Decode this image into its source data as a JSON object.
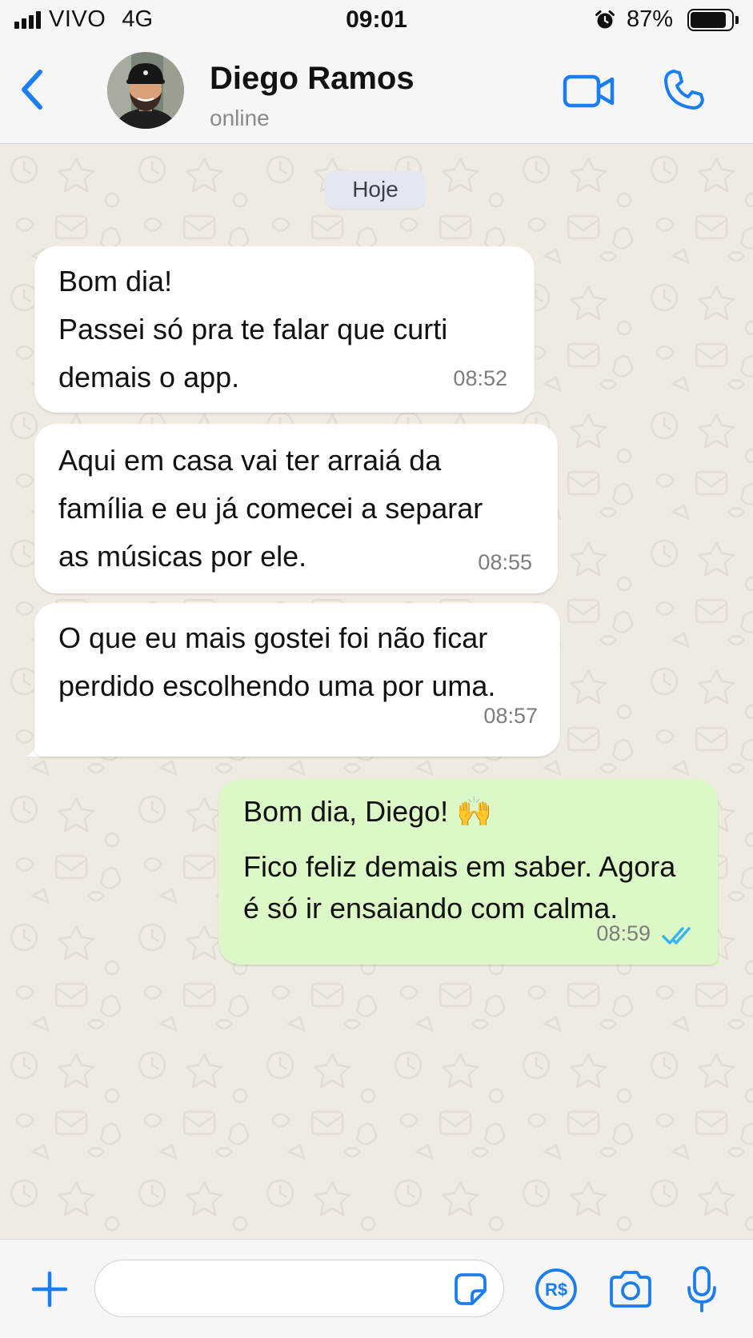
{
  "status_bar": {
    "carrier": "VIVO",
    "network": "4G",
    "time": "09:01",
    "battery_text": "87%",
    "battery_level": 0.87,
    "icons": [
      "signal-icon",
      "alarm-icon",
      "battery-icon"
    ]
  },
  "header": {
    "contact_name": "Diego Ramos",
    "contact_status": "online",
    "icons": [
      "back-chevron-icon",
      "avatar",
      "video-camera-icon",
      "phone-icon"
    ]
  },
  "chat": {
    "date_separator": "Hoje",
    "messages": [
      {
        "direction": "incoming",
        "lines": [
          "Bom dia!",
          "Passei só pra te falar que curti",
          "demais o app."
        ],
        "time": "08:52"
      },
      {
        "direction": "incoming",
        "lines": [
          "Aqui em casa vai ter arraiá da",
          "família e eu já comecei a separar",
          "as músicas por ele."
        ],
        "time": "08:55"
      },
      {
        "direction": "incoming",
        "lines": [
          "O que eu mais gostei foi não ficar",
          "perdido escolhendo uma por uma."
        ],
        "time": "08:57"
      },
      {
        "direction": "outgoing",
        "lines": [
          "Bom dia, Diego! 🙌",
          "Fico feliz demais em saber. Agora",
          "é só ir ensaiando com calma."
        ],
        "time": "08:59",
        "read_status": "read",
        "read_icon": "double-check-icon"
      }
    ]
  },
  "composer": {
    "input_value": "",
    "placeholder": "",
    "icons": [
      "plus-icon",
      "sticker-icon",
      "pay-icon",
      "camera-icon",
      "microphone-icon"
    ],
    "pay_label": "R$"
  },
  "colors": {
    "accent": "#1a7ef0",
    "incoming_bubble": "#ffffff",
    "outgoing_bubble": "#dcf8c6",
    "chat_background": "#efeae2",
    "read_check": "#34b7f1"
  }
}
